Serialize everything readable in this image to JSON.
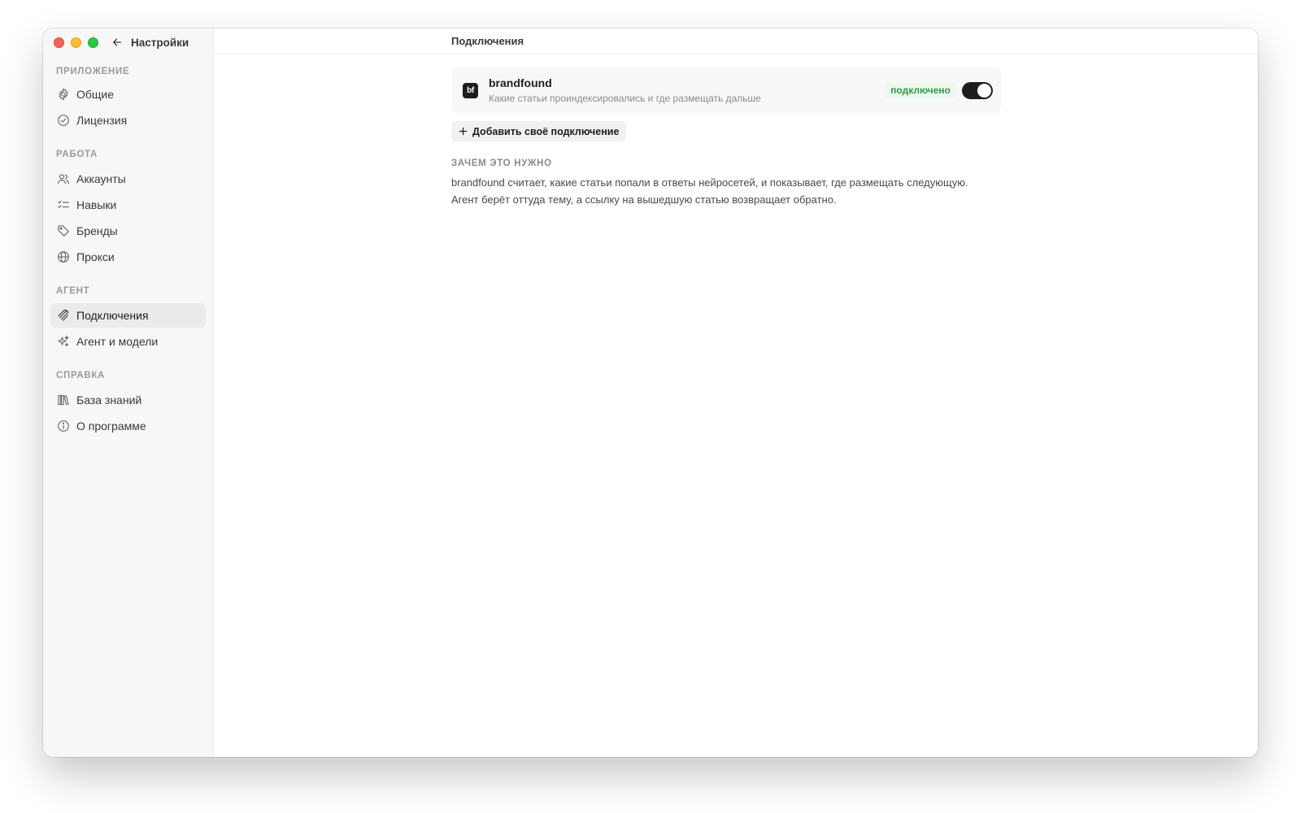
{
  "window": {
    "back_label": "Настройки",
    "header_title": "Подключения"
  },
  "sidebar": {
    "sections": [
      {
        "title": "ПРИЛОЖЕНИЕ",
        "items": [
          {
            "label": "Общие",
            "icon": "gear-icon"
          },
          {
            "label": "Лицензия",
            "icon": "check-circle-icon"
          }
        ]
      },
      {
        "title": "РАБОТА",
        "items": [
          {
            "label": "Аккаунты",
            "icon": "users-icon"
          },
          {
            "label": "Навыки",
            "icon": "list-check-icon"
          },
          {
            "label": "Бренды",
            "icon": "tag-icon"
          },
          {
            "label": "Прокси",
            "icon": "globe-icon"
          }
        ]
      },
      {
        "title": "АГЕНТ",
        "items": [
          {
            "label": "Подключения",
            "icon": "plug-icon",
            "active": true
          },
          {
            "label": "Агент и модели",
            "icon": "sparkles-icon"
          }
        ]
      },
      {
        "title": "СПРАВКА",
        "items": [
          {
            "label": "База знаний",
            "icon": "library-icon"
          },
          {
            "label": "О программе",
            "icon": "info-icon"
          }
        ]
      }
    ]
  },
  "connections": {
    "items": [
      {
        "logo_text": "bf",
        "name": "brandfound",
        "description": "Какие статьи проиндексировались и где размещать дальше",
        "status": "подключено",
        "enabled": true
      }
    ],
    "add_label": "Добавить своё подключение"
  },
  "why": {
    "title": "ЗАЧЕМ ЭТО НУЖНО",
    "line1": "brandfound считает, какие статьи попали в ответы нейросетей, и показывает, где размещать следующую.",
    "line2": "Агент берёт оттуда тему, а ссылку на вышедшую статью возвращает обратно."
  },
  "colors": {
    "accent_dark": "#1d1d1f",
    "status_green": "#2f9e44",
    "status_green_bg": "#eef7ef",
    "sidebar_bg": "#f7f7f7"
  }
}
